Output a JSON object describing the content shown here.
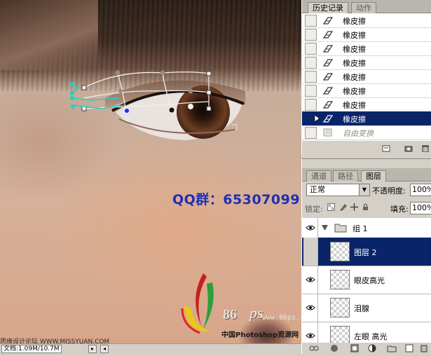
{
  "canvas": {
    "qq_text": "QQ群：65307099",
    "watermark": {
      "num": "86",
      "ps": "ps",
      "url": "www.86ps.com",
      "name": "中国Photoshop资源网",
      "site": "思缘设计论坛 WWW.MISSYUAN.COM"
    },
    "status": {
      "doc_size": "文档:1.09M/10.7M"
    }
  },
  "history": {
    "tabs": [
      "历史记录",
      "动作"
    ],
    "items": [
      {
        "label": "橡皮擦",
        "icon": "eraser-icon",
        "state": "normal"
      },
      {
        "label": "橡皮擦",
        "icon": "eraser-icon",
        "state": "normal"
      },
      {
        "label": "橡皮擦",
        "icon": "eraser-icon",
        "state": "normal"
      },
      {
        "label": "橡皮擦",
        "icon": "eraser-icon",
        "state": "normal"
      },
      {
        "label": "橡皮擦",
        "icon": "eraser-icon",
        "state": "normal"
      },
      {
        "label": "橡皮擦",
        "icon": "eraser-icon",
        "state": "normal"
      },
      {
        "label": "橡皮擦",
        "icon": "eraser-icon",
        "state": "normal"
      },
      {
        "label": "橡皮擦",
        "icon": "eraser-icon",
        "state": "selected"
      },
      {
        "label": "自由变换",
        "icon": "free-transform-icon",
        "state": "dimmed"
      }
    ]
  },
  "layers": {
    "tabs": [
      "通道",
      "路径",
      "图层"
    ],
    "blend_mode": "正常",
    "opacity_label": "不透明度:",
    "opacity_value": "100%",
    "lock_label": "锁定:",
    "fill_label": "填充:",
    "fill_value": "100%",
    "group_name": "组 1",
    "items": [
      {
        "name": "图层 2",
        "visible": false,
        "selected": true
      },
      {
        "name": "眼皮高光",
        "visible": true,
        "selected": false
      },
      {
        "name": "泪腺",
        "visible": true,
        "selected": false
      },
      {
        "name": "左眼 高光",
        "visible": true,
        "selected": false
      }
    ]
  },
  "colors": {
    "selection": "#0a246a",
    "qq_blue": "#1e2fb4",
    "panel_gray": "#d4d0c8"
  }
}
